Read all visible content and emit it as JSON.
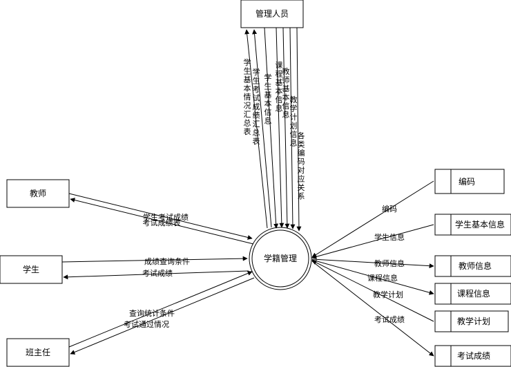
{
  "center": "学籍管理",
  "entities": {
    "admin": "管理人员",
    "teacher": "教师",
    "student": "学生",
    "head_teacher": "班主任"
  },
  "stores": [
    "编码",
    "学生基本信息",
    "教师信息",
    "课程信息",
    "教学计划",
    "考试成绩"
  ],
  "flows": {
    "admin_out_1": "学生基本情况汇总表",
    "admin_out_2": "学生考试成绩汇总表",
    "admin_in_1": "学生基本信息",
    "admin_in_2": "课程基本信息",
    "admin_in_3": "教师基本信息",
    "admin_in_4": "教学计划信息",
    "admin_in_5": "各类编码对应关系",
    "teacher_in": "学生考试成绩",
    "teacher_out": "考试成绩表",
    "student_in": "成绩查询条件",
    "student_out": "考试成绩",
    "head_in": "查询统计条件",
    "head_out": "考试通过情况",
    "store_code": "编码",
    "store_student": "学生信息",
    "store_teacher": "教师信息",
    "store_course": "课程信息",
    "store_plan": "教学计划",
    "store_score": "考试成绩"
  }
}
